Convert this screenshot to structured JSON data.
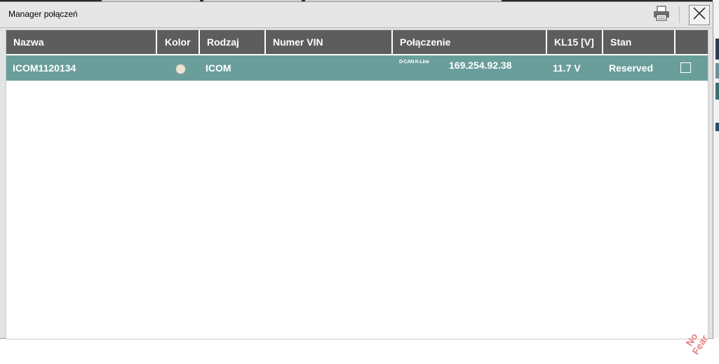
{
  "dialog": {
    "title": "Manager połączeń"
  },
  "table": {
    "columns": [
      "Nazwa",
      "Kolor",
      "Rodzaj",
      "Numer VIN",
      "Połączenie",
      "KL15 [V]",
      "Stan",
      ""
    ],
    "rows": [
      {
        "name": "ICOM1120134",
        "color": "#e9e3d4",
        "type": "ICOM",
        "vin": "",
        "connection_type": "D-CAN K-Line",
        "connection": "169.254.92.38",
        "kl15": "11.7 V",
        "status": "Reserved",
        "checked": false
      }
    ]
  },
  "watermark": {
    "line1": "No",
    "line2": "Fear"
  },
  "colors": {
    "header_bg": "#5d5d5d",
    "row_selected": "#6a9e9b"
  }
}
